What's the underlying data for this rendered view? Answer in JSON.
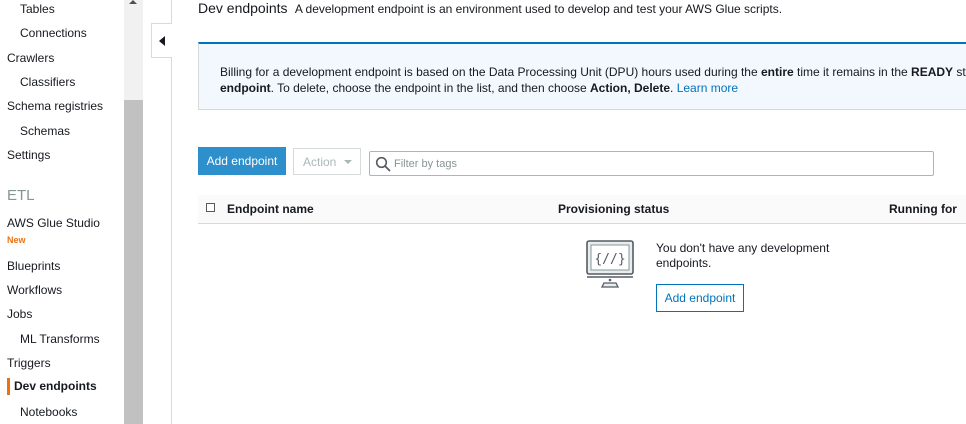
{
  "sidebar": {
    "items": [
      {
        "label": "Tables",
        "indent": true
      },
      {
        "label": "Connections",
        "indent": true
      },
      {
        "label": "Crawlers",
        "indent": false
      },
      {
        "label": "Classifiers",
        "indent": true
      },
      {
        "label": "Schema registries",
        "indent": false
      },
      {
        "label": "Schemas",
        "indent": true
      },
      {
        "label": "Settings",
        "indent": false
      }
    ],
    "section_etl": "ETL",
    "glue_studio": "AWS Glue Studio",
    "new_badge": "New",
    "etl_items": [
      {
        "label": "Blueprints",
        "indent": false
      },
      {
        "label": "Workflows",
        "indent": false
      },
      {
        "label": "Jobs",
        "indent": false
      },
      {
        "label": "ML Transforms",
        "indent": true
      },
      {
        "label": "Triggers",
        "indent": false
      }
    ],
    "active_item": "Dev endpoints",
    "notebooks": "Notebooks"
  },
  "header": {
    "title": "Dev endpoints",
    "description": "A development endpoint is an environment used to develop and test your AWS Glue scripts."
  },
  "info": {
    "text_1": "Billing for a development endpoint is based on the Data Processing Unit (DPU) hours used during the ",
    "bold_entire": "entire",
    "text_2": " time it remains in the ",
    "bold_ready": "READY",
    "text_3": " state",
    "bold_endpoint": "endpoint",
    "text_4": ". To delete, choose the endpoint in the list, and then choose ",
    "bold_action": "Action, Delete",
    "text_5": ". ",
    "learn_more": "Learn more"
  },
  "toolbar": {
    "add_label": "Add endpoint",
    "action_label": "Action",
    "filter_placeholder": "Filter by tags"
  },
  "table": {
    "columns": [
      "Endpoint name",
      "Provisioning status",
      "Running for"
    ]
  },
  "empty": {
    "message": "You don't have any development endpoints.",
    "button_label": "Add endpoint"
  },
  "colors": {
    "accent": "#ec7211",
    "primary_button": "#2d8fcb",
    "link": "#0073bb",
    "info_bg": "#f2f8fd"
  }
}
